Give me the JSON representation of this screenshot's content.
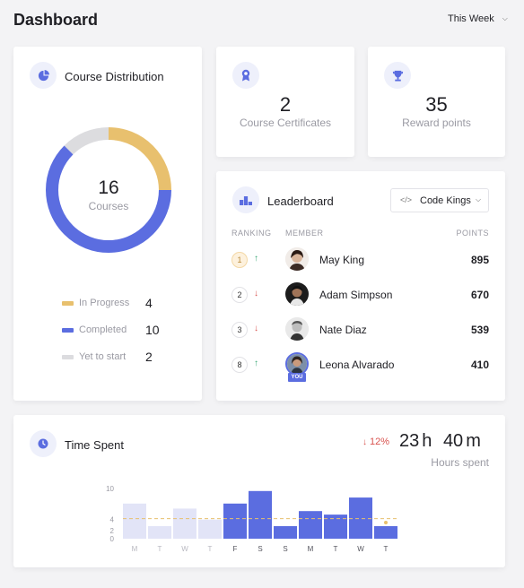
{
  "header": {
    "title": "Dashboard",
    "period_select": "This Week"
  },
  "course_distribution": {
    "title": "Course Distribution",
    "total": "16",
    "total_label": "Courses",
    "legend": [
      {
        "label": "In Progress",
        "value": "4",
        "color": "#e8c06e"
      },
      {
        "label": "Completed",
        "value": "10",
        "color": "#5b6de0"
      },
      {
        "label": "Yet to start",
        "value": "2",
        "color": "#dcdcdf"
      }
    ]
  },
  "certificates": {
    "value": "2",
    "label": "Course Certificates"
  },
  "reward": {
    "value": "35",
    "label": "Reward points"
  },
  "leaderboard": {
    "title": "Leaderboard",
    "filter": "Code Kings",
    "col_ranking": "RANKING",
    "col_member": "MEMBER",
    "col_points": "POINTS",
    "you_label": "YOU",
    "rows": [
      {
        "rank": "1",
        "trend": "up",
        "name": "May King",
        "points": "895"
      },
      {
        "rank": "2",
        "trend": "down",
        "name": "Adam Simpson",
        "points": "670"
      },
      {
        "rank": "3",
        "trend": "down",
        "name": "Nate Diaz",
        "points": "539"
      },
      {
        "rank": "8",
        "trend": "up",
        "name": "Leona Alvarado",
        "points": "410"
      }
    ]
  },
  "time_spent": {
    "title": "Time Spent",
    "change": "12%",
    "change_direction": "down",
    "hours": "23",
    "hours_unit": "h",
    "minutes": "40",
    "minutes_unit": "m",
    "subtitle": "Hours spent"
  },
  "chart_data": {
    "type": "bar",
    "categories": [
      "M",
      "T",
      "W",
      "T",
      "F",
      "S",
      "S",
      "M",
      "T",
      "W",
      "T"
    ],
    "values": [
      7,
      2.5,
      6,
      3.8,
      7,
      9.5,
      2.5,
      5.5,
      4.8,
      8.2,
      2.5
    ],
    "highlighted_from_index": 4,
    "yticks": [
      "10",
      "4",
      "2",
      "0"
    ],
    "average_line": 4,
    "colors": {
      "active": "#5b6de0",
      "inactive": "#e2e4f7",
      "average": "#e8c06e"
    }
  },
  "colors": {
    "accent": "#5b6de0",
    "gold": "#e8c06e",
    "up": "#3aa876",
    "down": "#d9534f"
  }
}
